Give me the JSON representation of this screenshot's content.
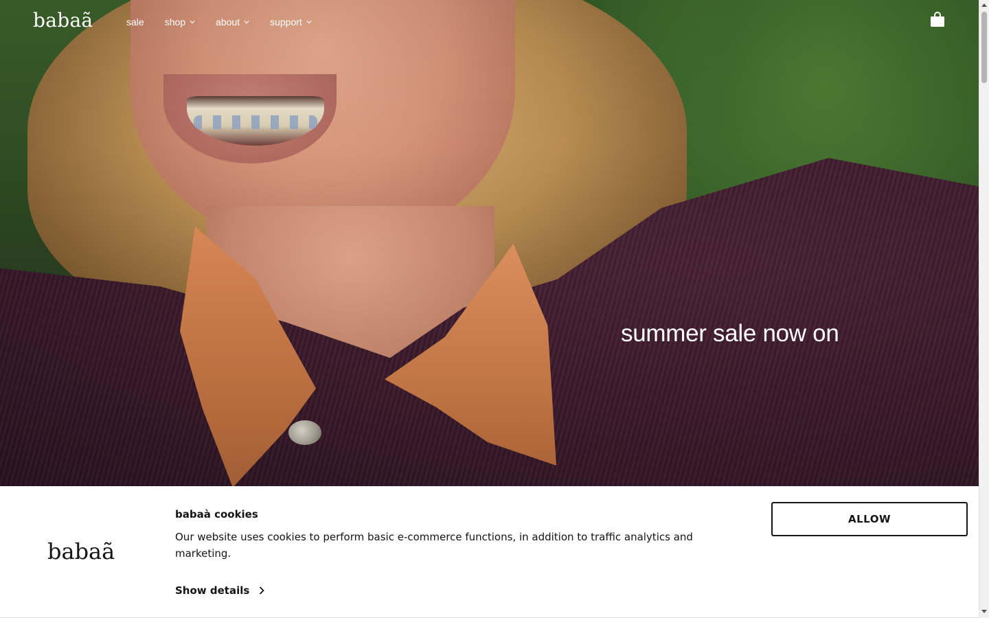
{
  "header": {
    "logo": "babaã",
    "nav": [
      {
        "label": "sale",
        "has_dropdown": false
      },
      {
        "label": "shop",
        "has_dropdown": true
      },
      {
        "label": "about",
        "has_dropdown": true
      },
      {
        "label": "support",
        "has_dropdown": true
      }
    ],
    "cart_icon": "shopping-bag-icon"
  },
  "hero": {
    "headline": "summer sale now on",
    "image_icon": "hero-photo"
  },
  "cookie_banner": {
    "logo": "babaã",
    "title": "babaà cookies",
    "text": "Our website uses cookies to perform basic e-commerce functions, in addition to traffic analytics and marketing.",
    "details_label": "Show details",
    "allow_label": "ALLOW"
  },
  "colors": {
    "text_dark": "#141414",
    "nav_text": "#ffffff",
    "banner_bg": "#ffffff"
  }
}
